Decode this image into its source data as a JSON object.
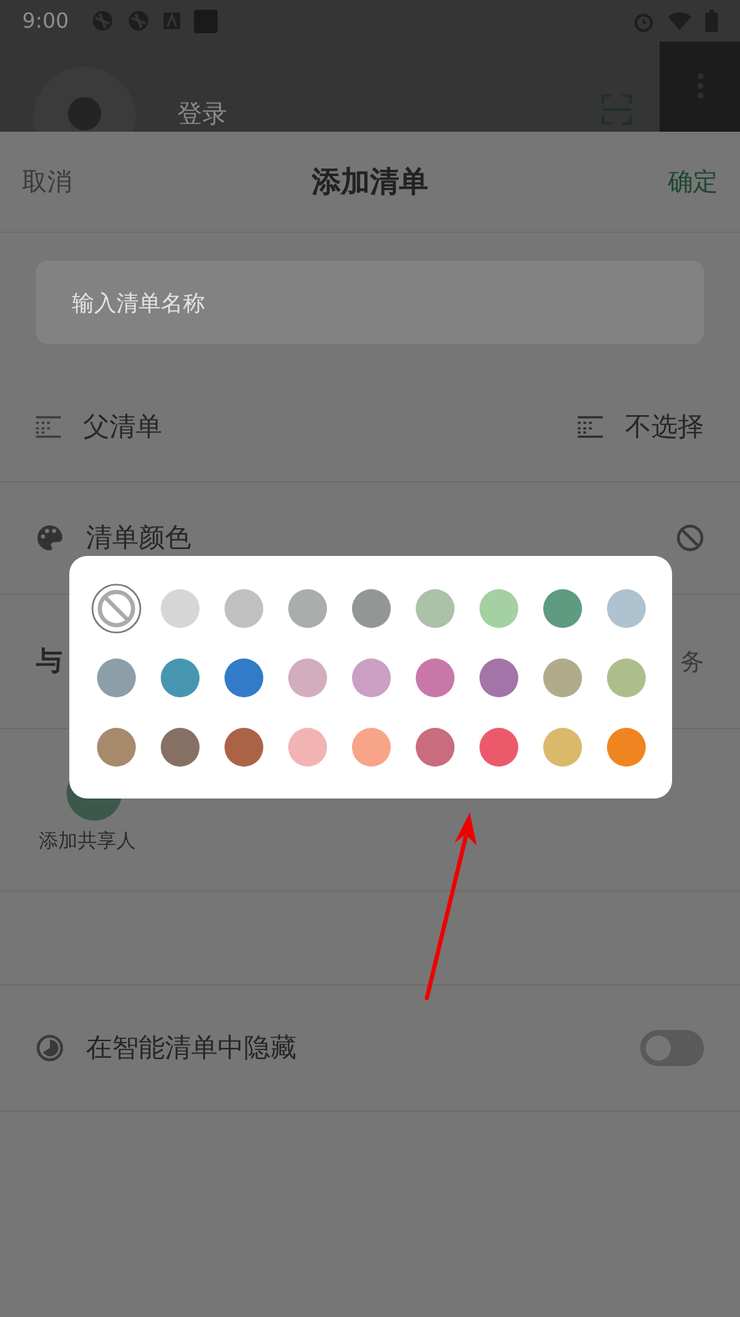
{
  "status_bar": {
    "time": "9:00"
  },
  "background": {
    "login_label": "登录"
  },
  "sheet": {
    "cancel": "取消",
    "title": "添加清单",
    "confirm": "确定",
    "name_field": {
      "placeholder": "输入清单名称"
    },
    "parent_row": {
      "label": "父清单",
      "value": "不选择"
    },
    "color_row": {
      "label": "清单颜色"
    },
    "share_section": {
      "title": "与",
      "right": "务",
      "add_label": "添加共享人"
    },
    "hide_row": {
      "label": "在智能清单中隐藏",
      "on": false
    }
  },
  "color_picker": {
    "swatches": [
      {
        "kind": "none",
        "selected": true
      },
      {
        "kind": "color",
        "color": "#d6d6d6",
        "selected": false
      },
      {
        "kind": "color",
        "color": "#c0c0c0",
        "selected": false
      },
      {
        "kind": "color",
        "color": "#a9adab",
        "selected": false
      },
      {
        "kind": "color",
        "color": "#929695",
        "selected": false
      },
      {
        "kind": "color",
        "color": "#abc1a8",
        "selected": false
      },
      {
        "kind": "color",
        "color": "#a4d0a2",
        "selected": false
      },
      {
        "kind": "color",
        "color": "#5f9b80",
        "selected": false
      },
      {
        "kind": "color",
        "color": "#aec2cf",
        "selected": false
      },
      {
        "kind": "color",
        "color": "#8c9ea7",
        "selected": false
      },
      {
        "kind": "color",
        "color": "#4696b1",
        "selected": false
      },
      {
        "kind": "color",
        "color": "#317bc7",
        "selected": false
      },
      {
        "kind": "color",
        "color": "#d1adbd",
        "selected": false
      },
      {
        "kind": "color",
        "color": "#cc9fc4",
        "selected": false
      },
      {
        "kind": "color",
        "color": "#c878a8",
        "selected": false
      },
      {
        "kind": "color",
        "color": "#a274a8",
        "selected": false
      },
      {
        "kind": "color",
        "color": "#b0ac8b",
        "selected": false
      },
      {
        "kind": "color",
        "color": "#adbe8b",
        "selected": false
      },
      {
        "kind": "color",
        "color": "#a78a6c",
        "selected": false
      },
      {
        "kind": "color",
        "color": "#857063",
        "selected": false
      },
      {
        "kind": "color",
        "color": "#ab6348",
        "selected": false
      },
      {
        "kind": "color",
        "color": "#f2b3b3",
        "selected": false
      },
      {
        "kind": "color",
        "color": "#f8a488",
        "selected": false
      },
      {
        "kind": "color",
        "color": "#c96c7e",
        "selected": false
      },
      {
        "kind": "color",
        "color": "#eb5a6b",
        "selected": false
      },
      {
        "kind": "color",
        "color": "#dbb96a",
        "selected": false
      },
      {
        "kind": "color",
        "color": "#ef8520",
        "selected": false
      }
    ]
  }
}
